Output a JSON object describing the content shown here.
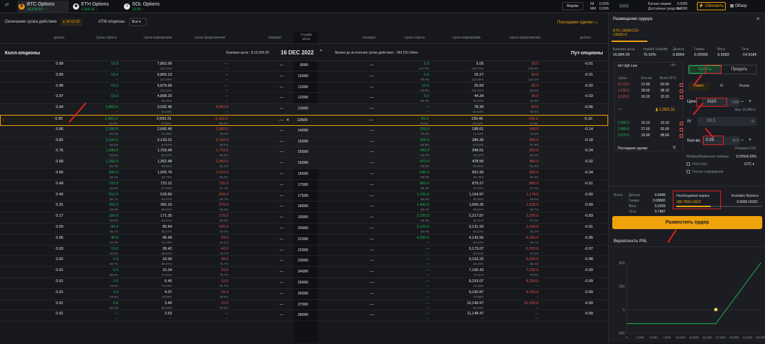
{
  "topbar": {
    "tabs": [
      {
        "name": "BTC Options",
        "price": "16,878.54 ↑",
        "icon": "btc-icon"
      },
      {
        "name": "ETH Options",
        "price": "1,266.15 ↑",
        "icon": "eth-icon"
      },
      {
        "name": "SOL Options",
        "price": "13.65 ↑",
        "icon": "sol-icon"
      }
    ],
    "regular_label": "Regular",
    "im_label": "IM",
    "im_value": "0.03%",
    "mm_label": "MM",
    "mm_value": "0.03%",
    "balance_label": "Баланс маржи",
    "balance_value": "0.0000",
    "available_label": "Доступные средства",
    "available_value": "0.0000",
    "refresh_label": "Обновить",
    "review_label": "Обзор"
  },
  "filters": {
    "expiry_label": "Окончание срока действия",
    "expiry_value": "16-12-22",
    "atm_label": "ATM опционы",
    "atm_value": "Все",
    "recent_trades": "Последние сделки"
  },
  "chain": {
    "headers_calls": [
      "дельта",
      "Цена спроса",
      "Цена маркировки",
      "Цена предложения",
      "позиция"
    ],
    "header_strike": "Страйк цена",
    "headers_puts": [
      "позиция",
      "Цена спроса",
      "Цена маркировки",
      "Цена предложения",
      "дельта"
    ],
    "calls_title": "Колл-опционы",
    "puts_title": "Пут-опционы",
    "base_price": "Базовая цена : $ 16,000.00",
    "expiry_date": "16 DEC 2022",
    "time_left": "Время до истечения срока действия : 18d 21h 54mn",
    "rows": [
      {
        "strike": "9000",
        "cd": "0.99",
        "cb": "10.0",
        "cbi": "—",
        "cm": "7,862.00",
        "cmi": "126.70%",
        "ca": "—",
        "cai": "—",
        "pb": "5.0",
        "pbi": "117.0%",
        "pm": "9.05",
        "pmi": "126.70%",
        "pa": "20.0",
        "pai": "139.6%",
        "pd": "-0.01"
      },
      {
        "strike": "10000",
        "cd": "0.99",
        "cb": "15.0",
        "cbi": "—",
        "cm": "6,869.13",
        "cmi": "113.06%",
        "ca": "—",
        "cai": "—",
        "pb": "5.0",
        "pbi": "99.0%",
        "pm": "16.27",
        "pmi": "113.06%",
        "pa": "30.0",
        "pai": "123.3%",
        "pd": "-0.01"
      },
      {
        "strike": "11000",
        "cd": "0.98",
        "cb": "15.0",
        "cbi": "—",
        "cm": "5,879.60",
        "cmi": "102.02%",
        "ca": "—",
        "cai": "—",
        "pb": "10.0",
        "pbi": "94.8%",
        "pm": "25.83",
        "pmi": "102.02%",
        "pa": "20.0",
        "pai": "99.6%",
        "pd": "-0.02"
      },
      {
        "strike": "12000",
        "cd": "0.97",
        "cb": "10.0",
        "cbi": "—",
        "cm": "4,898.20",
        "cmi": "91.03%",
        "ca": "—",
        "cai": "—",
        "pb": "5.0",
        "pbi": "86.4%",
        "pm": "44.34",
        "pmi": "91.03%",
        "pa": "30.0",
        "pai": "95.8%",
        "pd": "-0.03"
      },
      {
        "strike": "13000",
        "cd": "0.94",
        "cb": "3,800.0",
        "cbi": "—",
        "cm": "3,932.46",
        "cmi": "84.93%",
        "ca": "4,050.0",
        "cai": "—",
        "pb": "—",
        "pbi": "—",
        "pm": "78.30",
        "pmi": "84.93%",
        "pa": "80.0",
        "pai": "80.9%",
        "pd": "-0.06"
      },
      {
        "strike": "13500",
        "cd": "0.90",
        "cb": "2,890.0",
        "cbi": "54.0%",
        "cm": "2,993.31",
        "cmi": "75.02%",
        "ca": "3,110.0",
        "cai": "90.0%",
        "pb": "50.0",
        "pbi": "70.6%",
        "pm": "159.46",
        "pmi": "75.02%",
        "pa": "145.0",
        "pai": "73.8%",
        "pd": "-0.10"
      },
      {
        "strike": "14000",
        "cd": "0.86",
        "cb": "2,580.0",
        "cbi": "56.4%",
        "cm": "2,642.46",
        "cmi": "71.53%",
        "ca": "2,690.0",
        "cai": "76.4%",
        "pb": "100.0",
        "pbi": "75.6%",
        "pm": "188.61",
        "pmi": "71.53%",
        "pa": "145.0",
        "pai": "76.4%",
        "pd": "-0.14"
      },
      {
        "strike": "15000",
        "cd": "0.82",
        "cb": "2,100.0",
        "cbi": "66.2%",
        "cm": "2,133.21",
        "cmi": "67.93%",
        "ca": "2,150.0",
        "cai": "69.5%",
        "pb": "250.0",
        "pbi": "66.8%",
        "pm": "286.39",
        "pmi": "67.93%",
        "pa": "300.0",
        "pai": "67.8%",
        "pd": "-0.18"
      },
      {
        "strike": "15500",
        "cd": "0.76",
        "cb": "1,680.0",
        "cbi": "63.2%",
        "cm": "1,703.49",
        "cmi": "64.07%",
        "ca": "1,715.0",
        "cai": "65.1%",
        "pb": "340.0",
        "pbi": "63.2%",
        "pm": "349.61",
        "pmi": "64.07%",
        "pa": "360.0",
        "pai": "64.2%",
        "pd": "-0.24"
      },
      {
        "strike": "16000",
        "cd": "0.68",
        "cb": "1,350.0",
        "cbi": "60.4%",
        "cm": "1,352.48",
        "cmi": "60.91%",
        "ca": "1,360.0",
        "cai": "61.2%",
        "pb": "470.0",
        "pbi": "60.6%",
        "pm": "478.56",
        "pmi": "60.91%",
        "pa": "490.0",
        "pai": "61.9%",
        "pd": "-0.32"
      },
      {
        "strike": "16500",
        "cd": "0.66",
        "cb": "990.0",
        "cbi": "58.1%",
        "cm": "1,005.76",
        "cmi": "58.78%",
        "ca": "1,010.0",
        "cai": "59.0%",
        "pb": "640.0",
        "pbi": "58.0%",
        "pm": "651.90",
        "pmi": "58.78%",
        "pa": "660.0",
        "pai": "59.3%",
        "pd": "-0.34"
      },
      {
        "strike": "17000",
        "cd": "0.49",
        "cb": "720.0",
        "cbi": "56.9%",
        "cm": "723.12",
        "cmi": "57.02%",
        "ca": "730.0",
        "cai": "57.4%",
        "pb": "860.0",
        "pbi": "56.4%",
        "pm": "879.27",
        "pmi": "57.02%",
        "pa": "890.0",
        "pai": "57.4%",
        "pd": "-0.51"
      },
      {
        "strike": "17500",
        "cd": "0.40",
        "cb": "510.0",
        "cbi": "55.7%",
        "cm": "518.83",
        "cmi": "55.97%",
        "ca": "530.0",
        "cai": "56.7%",
        "pb": "1,150.0",
        "pbi": "55.5%",
        "pm": "1,164.97",
        "pmi": "55.96%",
        "pa": "1,178.0",
        "pai": "56.5%",
        "pd": "-0.60"
      },
      {
        "strike": "18000",
        "cd": "0.31",
        "cb": "350.0",
        "cbi": "55.3%",
        "cm": "360.16",
        "cmi": "55.61%",
        "ca": "370.0",
        "cai": "56.0%",
        "pb": "1,490.0",
        "pbi": "55.1%",
        "pm": "1,506.35",
        "pmi": "55.61%",
        "pa": "1,520.0",
        "pai": "56.7%",
        "pd": "-0.69"
      },
      {
        "strike": "19000",
        "cd": "0.17",
        "cb": "160.0",
        "cbi": "55.6%",
        "cm": "171.35",
        "cmi": "56.41%",
        "ca": "175.0",
        "cai": "56.6%",
        "pb": "2,160.0",
        "pbi": "55.4%",
        "pm": "2,217.87",
        "pmi": "56.41%",
        "pa": "2,230.0",
        "pai": "57.3%",
        "pd": "-0.83"
      },
      {
        "strike": "20000",
        "cd": "0.09",
        "cb": "80.0",
        "cbi": "58.1%",
        "cm": "85.84",
        "cmi": "58.23%",
        "ca": "100.0",
        "cai": "63.0%",
        "pb": "3,120.0",
        "pbi": "55.0%",
        "pm": "3,131.93",
        "pmi": "58.23%",
        "pa": "3,160.0",
        "pai": "62.3%",
        "pd": "-0.91"
      },
      {
        "strike": "21000",
        "cd": "0.06",
        "cb": "40.0",
        "cbi": "60.7%",
        "cm": "45.49",
        "cmi": "62.43%",
        "ca": "50.0",
        "cai": "63.1%",
        "pb": "4,090.0",
        "pbi": "—",
        "pm": "4,142.56",
        "pmi": "62.43%",
        "pa": "4,160.0",
        "pai": "69.7%",
        "pd": "-0.95"
      },
      {
        "strike": "22000",
        "cd": "0.03",
        "cb": "15.0",
        "cbi": "60.5%",
        "cm": "28.42",
        "cmi": "66.64%",
        "ca": "40.0",
        "cai": "76.7%",
        "pb": "—",
        "pbi": "—",
        "pm": "5,173.07",
        "pmi": "66.64%",
        "pa": "5,220.0",
        "pai": "87.6%",
        "pd": "-0.97"
      },
      {
        "strike": "23000",
        "cd": "0.02",
        "cb": "2.0",
        "cbi": "59.7%",
        "cm": "16.00",
        "cmi": "69.20%",
        "ca": "30.0",
        "cai": "76.7%",
        "pb": "—",
        "pbi": "—",
        "pm": "6,163.22",
        "pmi": "69.20%",
        "pa": "6,230.0",
        "pai": "86.4%",
        "pd": "-0.98"
      },
      {
        "strike": "24000",
        "cd": "0.01",
        "cb": "5.0",
        "cbi": "68.5%",
        "cm": "10.34",
        "cmi": "72.61%",
        "ca": "20.0",
        "cai": "78.7%",
        "pb": "—",
        "pbi": "—",
        "pm": "7,156.43",
        "pmi": "72.61%",
        "pa": "7,230.0",
        "pai": "96.8%",
        "pd": "-0.99"
      },
      {
        "strike": "25000",
        "cd": "0.01",
        "cb": "2.0",
        "cbi": "73.3%",
        "cm": "6.45",
        "cmi": "76.03%",
        "ca": "10.0",
        "cai": "82.7%",
        "pb": "—",
        "pbi": "—",
        "pm": "8,153.07",
        "pmi": "76.03%",
        "pa": "8,230.0",
        "pai": "—",
        "pd": "-0.99"
      },
      {
        "strike": "26000",
        "cd": "0.01",
        "cb": "1.0",
        "cbi": "79.6%",
        "cm": "4.37",
        "cmi": "78.95%",
        "ca": "15.0",
        "cai": "95.6%",
        "pb": "—",
        "pbi": "—",
        "pm": "9,150.87",
        "pmi": "78.95%",
        "pa": "9,230.0",
        "pai": "—",
        "pd": "-0.99"
      },
      {
        "strike": "27000",
        "cd": "0.01",
        "cb": "0.5",
        "cbi": "80.2%",
        "cm": "3.45",
        "cmi": "82.03%",
        "ca": "10.0",
        "cai": "97.5%",
        "pb": "—",
        "pbi": "—",
        "pm": "10,149.97",
        "pmi": "82.03%",
        "pa": "10,230.0",
        "pai": "—",
        "pd": "-0.99"
      },
      {
        "strike": "28000",
        "cd": "0.01",
        "cb": "—",
        "cbi": "—",
        "cm": "2.53",
        "cmi": "—",
        "ca": "—",
        "cai": "—",
        "pb": "—",
        "pbi": "—",
        "pm": "11,148.47",
        "pmi": "—",
        "pa": "—",
        "pai": "—",
        "pd": "-0.99"
      }
    ]
  },
  "panel": {
    "title": "Размещение ордера",
    "symbol": "BTC-16DEC22-13500-C",
    "stats_labels": [
      "Базовая цена",
      "Implied Volatility",
      "Дельта",
      "Гамма",
      "Вега",
      "Тета"
    ],
    "stats_values": [
      "16,884.05",
      "75.02%",
      "0.8964",
      "0.00006",
      "6.5583",
      "-14.9184"
    ],
    "iv_curve_label": "Ioh Ugh Low",
    "ob_headers": [
      "Цена",
      "Кол-во",
      "Всего BTC"
    ],
    "asks": [
      [
        "3,170.0",
        "21.90",
        "60.00"
      ],
      [
        "3,150.0",
        "28.00",
        "38.10"
      ],
      [
        "3,110.0",
        "10.10",
        "10.10"
      ]
    ],
    "mid_price": "2,993.31",
    "bids": [
      [
        "2,890.0",
        "10.10",
        "10.10"
      ],
      [
        "2,880.0",
        "27.00",
        "52.00"
      ],
      [
        "2,870.0",
        "33.90",
        "98.00"
      ]
    ],
    "recent_trades": "Последние сделки",
    "buy_label": "Купить",
    "sell_label": "Продать",
    "order_types": [
      "Лимит",
      "IV",
      "Рынок"
    ],
    "price_label": "Цена",
    "price_value": "3110",
    "price_unit": "USD",
    "max_price": "Max 10,986.0",
    "iv_label": "IV",
    "iv_value": "89.5",
    "iv_unit": "%",
    "qty_label": "Кол-во",
    "qty_value": "0.05",
    "qty_unit": "BTC",
    "position": "Позиция 0.00",
    "fee_label": "Мейкер/Комиссия тейкера",
    "fee_value": "0.03%/0.03%",
    "post_only": "Post-Only",
    "reduce_only": "Только сокращение",
    "gtc": "GTC",
    "greeks_labels": [
      "Всего",
      "Дельта",
      "Гамма",
      "Вега",
      "Тета"
    ],
    "greeks_values": [
      "0.0448",
      "0.00000",
      "0.3169",
      "0.7487"
    ],
    "margin_label": "Необходимая маржа",
    "margin_value": "188.7800 USDC",
    "available_label": "Available Balance",
    "available_value": "0.0000 USDC",
    "place_order": "Разместить ордер",
    "pnl_title": "Вероятность PNL"
  },
  "chart_data": {
    "type": "line",
    "title": "Вероятность PNL",
    "x_ticks": [
      "0",
      "2,500",
      "5,000",
      "7,500",
      "10,000",
      "12,500",
      "15,000",
      "17,500",
      "20,000",
      "22,500",
      "25,000"
    ],
    "y_ticks": [
      "0",
      "-250",
      "250",
      "500"
    ],
    "series": [
      {
        "points": [
          [
            0,
            -150
          ],
          [
            16610,
            -150
          ],
          [
            25000,
            500
          ]
        ]
      }
    ],
    "breakeven_x": 16610,
    "xlim": [
      0,
      25000
    ],
    "ylim": [
      -250,
      500
    ]
  },
  "colors": {
    "accent": "#f0a30a",
    "bid": "#1db954",
    "ask": "#e5534b",
    "bg": "#17181c"
  }
}
